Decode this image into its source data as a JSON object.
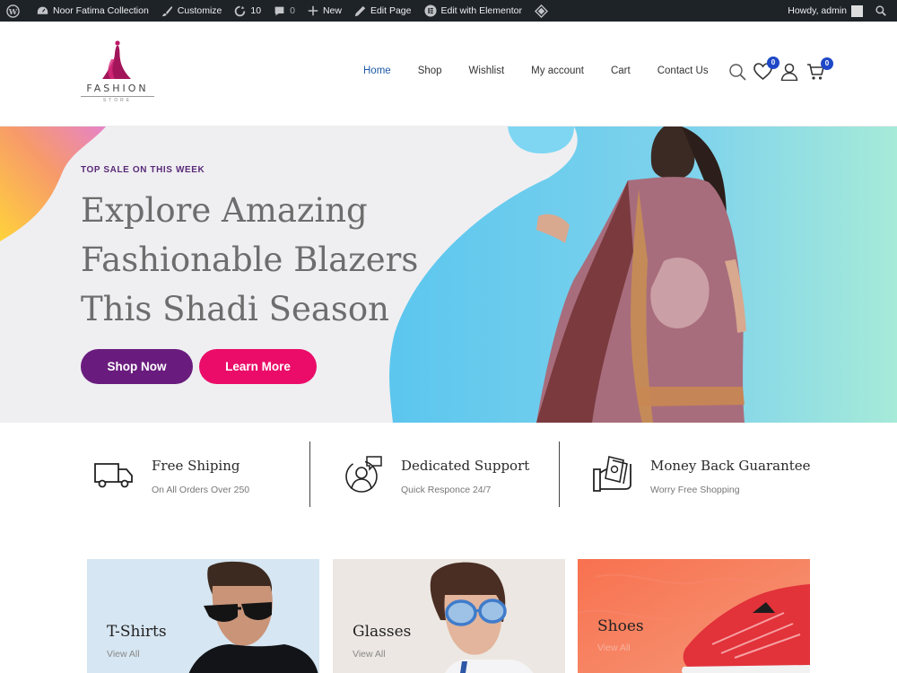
{
  "adminbar": {
    "site_name": "Noor Fatima Collection",
    "customize": "Customize",
    "updates": "10",
    "comments": "0",
    "new": "New",
    "edit_page": "Edit Page",
    "edit_elementor": "Edit with Elementor",
    "howdy": "Howdy, admin"
  },
  "logo": {
    "name": "FASHION",
    "tagline": "STORE"
  },
  "nav": {
    "items": [
      {
        "label": "Home",
        "active": true
      },
      {
        "label": "Shop"
      },
      {
        "label": "Wishlist"
      },
      {
        "label": "My account"
      },
      {
        "label": "Cart"
      },
      {
        "label": "Contact Us"
      }
    ]
  },
  "header_icons": {
    "wishlist_count": "0",
    "cart_count": "0"
  },
  "hero": {
    "eyebrow": "TOP SALE ON THIS WEEK",
    "title_lines": [
      "Explore Amazing",
      "Fashionable Blazers",
      "This Shadi Season"
    ],
    "primary_button": "Shop Now",
    "secondary_button": "Learn More"
  },
  "features": [
    {
      "title": "Free Shiping",
      "subtitle": "On All Orders Over 250",
      "icon": "truck-icon"
    },
    {
      "title": "Dedicated Support",
      "subtitle": "Quick Responce 24/7",
      "icon": "support-icon"
    },
    {
      "title": "Money Back Guarantee",
      "subtitle": "Worry Free Shopping",
      "icon": "money-icon"
    }
  ],
  "categories": [
    {
      "title": "T-Shirts",
      "link": "View All"
    },
    {
      "title": "Glasses",
      "link": "View All"
    },
    {
      "title": "Shoes",
      "link": "View All"
    }
  ],
  "colors": {
    "accent_purple": "#6a1c7e",
    "accent_pink": "#ea0c68",
    "nav_active": "#1e5aa8",
    "badge": "#1e48c7"
  }
}
